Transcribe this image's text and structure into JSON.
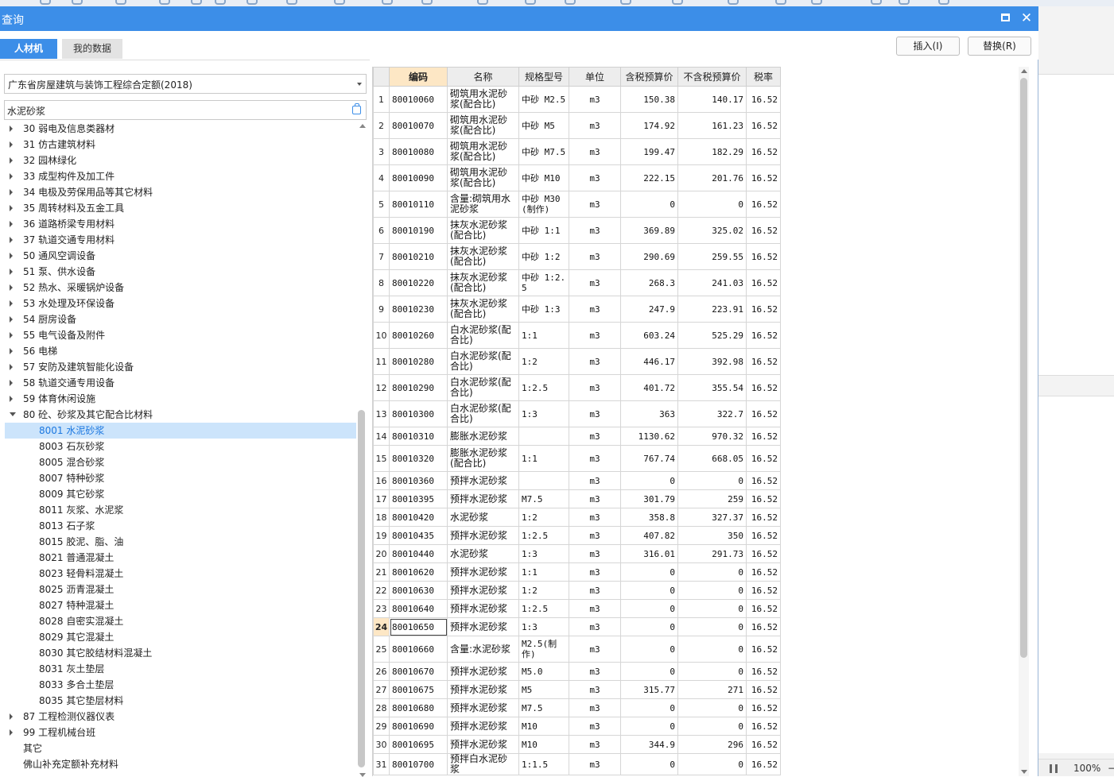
{
  "window": {
    "title": "查询"
  },
  "tabs": [
    {
      "label": "人材机",
      "active": true
    },
    {
      "label": "我的数据",
      "active": false
    }
  ],
  "toolbar": {
    "insert_label": "插入(I)",
    "replace_label": "替换(R)"
  },
  "quota_select": {
    "value": "广东省房屋建筑与装饰工程综合定额(2018)"
  },
  "search": {
    "value": "水泥砂浆"
  },
  "tree": [
    {
      "label": "30 弱电及信息类器材",
      "level": 0,
      "state": "collapsed"
    },
    {
      "label": "31 仿古建筑材料",
      "level": 0,
      "state": "collapsed"
    },
    {
      "label": "32 园林绿化",
      "level": 0,
      "state": "collapsed"
    },
    {
      "label": "33 成型构件及加工件",
      "level": 0,
      "state": "collapsed"
    },
    {
      "label": "34 电极及劳保用品等其它材料",
      "level": 0,
      "state": "collapsed"
    },
    {
      "label": "35 周转材料及五金工具",
      "level": 0,
      "state": "collapsed"
    },
    {
      "label": "36 道路桥梁专用材料",
      "level": 0,
      "state": "collapsed"
    },
    {
      "label": "37 轨道交通专用材料",
      "level": 0,
      "state": "collapsed"
    },
    {
      "label": "50 通风空调设备",
      "level": 0,
      "state": "collapsed"
    },
    {
      "label": "51 泵、供水设备",
      "level": 0,
      "state": "collapsed"
    },
    {
      "label": "52 热水、采暖锅炉设备",
      "level": 0,
      "state": "collapsed"
    },
    {
      "label": "53 水处理及环保设备",
      "level": 0,
      "state": "collapsed"
    },
    {
      "label": "54 厨房设备",
      "level": 0,
      "state": "collapsed"
    },
    {
      "label": "55 电气设备及附件",
      "level": 0,
      "state": "collapsed"
    },
    {
      "label": "56 电梯",
      "level": 0,
      "state": "collapsed"
    },
    {
      "label": "57 安防及建筑智能化设备",
      "level": 0,
      "state": "collapsed"
    },
    {
      "label": "58 轨道交通专用设备",
      "level": 0,
      "state": "collapsed"
    },
    {
      "label": "59 体育休闲设施",
      "level": 0,
      "state": "collapsed"
    },
    {
      "label": "80 砼、砂浆及其它配合比材料",
      "level": 0,
      "state": "expanded"
    },
    {
      "label": "8001 水泥砂浆",
      "level": 1,
      "state": "leaf",
      "selected": true
    },
    {
      "label": "8003 石灰砂浆",
      "level": 1,
      "state": "leaf"
    },
    {
      "label": "8005 混合砂浆",
      "level": 1,
      "state": "leaf"
    },
    {
      "label": "8007 特种砂浆",
      "level": 1,
      "state": "leaf"
    },
    {
      "label": "8009 其它砂浆",
      "level": 1,
      "state": "leaf"
    },
    {
      "label": "8011 灰浆、水泥浆",
      "level": 1,
      "state": "leaf"
    },
    {
      "label": "8013 石子浆",
      "level": 1,
      "state": "leaf"
    },
    {
      "label": "8015 胶泥、脂、油",
      "level": 1,
      "state": "leaf"
    },
    {
      "label": "8021 普通混凝土",
      "level": 1,
      "state": "leaf"
    },
    {
      "label": "8023 轻骨料混凝土",
      "level": 1,
      "state": "leaf"
    },
    {
      "label": "8025 沥青混凝土",
      "level": 1,
      "state": "leaf"
    },
    {
      "label": "8027 特种混凝土",
      "level": 1,
      "state": "leaf"
    },
    {
      "label": "8028 自密实混凝土",
      "level": 1,
      "state": "leaf"
    },
    {
      "label": "8029 其它混凝土",
      "level": 1,
      "state": "leaf"
    },
    {
      "label": "8030 其它胶结材料混凝土",
      "level": 1,
      "state": "leaf"
    },
    {
      "label": "8031 灰土垫层",
      "level": 1,
      "state": "leaf"
    },
    {
      "label": "8033 多合土垫层",
      "level": 1,
      "state": "leaf"
    },
    {
      "label": "8035 其它垫层材料",
      "level": 1,
      "state": "leaf"
    },
    {
      "label": "87 工程检测仪器仪表",
      "level": 0,
      "state": "collapsed"
    },
    {
      "label": "99 工程机械台班",
      "level": 0,
      "state": "collapsed"
    },
    {
      "label": "其它",
      "level": 0,
      "state": "none"
    },
    {
      "label": "佛山补充定额补充材料",
      "level": 0,
      "state": "none"
    }
  ],
  "grid": {
    "columns": [
      "编码",
      "名称",
      "规格型号",
      "单位",
      "含税预算价",
      "不含税预算价",
      "税率"
    ],
    "current_row": 24,
    "rows": [
      {
        "n": "1",
        "code": "80010060",
        "name": "砌筑用水泥砂浆(配合比)",
        "spec": "中砂 M2.5",
        "unit": "m3",
        "tax_price": "150.38",
        "notax_price": "140.17",
        "rate": "16.52"
      },
      {
        "n": "2",
        "code": "80010070",
        "name": "砌筑用水泥砂浆(配合比)",
        "spec": "中砂 M5",
        "unit": "m3",
        "tax_price": "174.92",
        "notax_price": "161.23",
        "rate": "16.52"
      },
      {
        "n": "3",
        "code": "80010080",
        "name": "砌筑用水泥砂浆(配合比)",
        "spec": "中砂 M7.5",
        "unit": "m3",
        "tax_price": "199.47",
        "notax_price": "182.29",
        "rate": "16.52"
      },
      {
        "n": "4",
        "code": "80010090",
        "name": "砌筑用水泥砂浆(配合比)",
        "spec": "中砂 M10",
        "unit": "m3",
        "tax_price": "222.15",
        "notax_price": "201.76",
        "rate": "16.52"
      },
      {
        "n": "5",
        "code": "80010110",
        "name": "含量:砌筑用水泥砂浆",
        "spec": "中砂 M30(制作)",
        "unit": "m3",
        "tax_price": "0",
        "notax_price": "0",
        "rate": "16.52"
      },
      {
        "n": "6",
        "code": "80010190",
        "name": "抹灰水泥砂浆(配合比)",
        "spec": "中砂 1:1",
        "unit": "m3",
        "tax_price": "369.89",
        "notax_price": "325.02",
        "rate": "16.52"
      },
      {
        "n": "7",
        "code": "80010210",
        "name": "抹灰水泥砂浆(配合比)",
        "spec": "中砂 1:2",
        "unit": "m3",
        "tax_price": "290.69",
        "notax_price": "259.55",
        "rate": "16.52"
      },
      {
        "n": "8",
        "code": "80010220",
        "name": "抹灰水泥砂浆(配合比)",
        "spec": "中砂 1:2.5",
        "unit": "m3",
        "tax_price": "268.3",
        "notax_price": "241.03",
        "rate": "16.52"
      },
      {
        "n": "9",
        "code": "80010230",
        "name": "抹灰水泥砂浆(配合比)",
        "spec": "中砂 1:3",
        "unit": "m3",
        "tax_price": "247.9",
        "notax_price": "223.91",
        "rate": "16.52"
      },
      {
        "n": "10",
        "code": "80010260",
        "name": "白水泥砂浆(配合比)",
        "spec": "1:1",
        "unit": "m3",
        "tax_price": "603.24",
        "notax_price": "525.29",
        "rate": "16.52"
      },
      {
        "n": "11",
        "code": "80010280",
        "name": "白水泥砂浆(配合比)",
        "spec": "1:2",
        "unit": "m3",
        "tax_price": "446.17",
        "notax_price": "392.98",
        "rate": "16.52"
      },
      {
        "n": "12",
        "code": "80010290",
        "name": "白水泥砂浆(配合比)",
        "spec": "1:2.5",
        "unit": "m3",
        "tax_price": "401.72",
        "notax_price": "355.54",
        "rate": "16.52"
      },
      {
        "n": "13",
        "code": "80010300",
        "name": "白水泥砂浆(配合比)",
        "spec": "1:3",
        "unit": "m3",
        "tax_price": "363",
        "notax_price": "322.7",
        "rate": "16.52"
      },
      {
        "n": "14",
        "code": "80010310",
        "name": "膨胀水泥砂浆",
        "spec": "",
        "unit": "m3",
        "tax_price": "1130.62",
        "notax_price": "970.32",
        "rate": "16.52"
      },
      {
        "n": "15",
        "code": "80010320",
        "name": "膨胀水泥砂浆(配合比)",
        "spec": "1:1",
        "unit": "m3",
        "tax_price": "767.74",
        "notax_price": "668.05",
        "rate": "16.52"
      },
      {
        "n": "16",
        "code": "80010360",
        "name": "预拌水泥砂浆",
        "spec": "",
        "unit": "m3",
        "tax_price": "0",
        "notax_price": "0",
        "rate": "16.52"
      },
      {
        "n": "17",
        "code": "80010395",
        "name": "预拌水泥砂浆",
        "spec": "M7.5",
        "unit": "m3",
        "tax_price": "301.79",
        "notax_price": "259",
        "rate": "16.52"
      },
      {
        "n": "18",
        "code": "80010420",
        "name": "水泥砂浆",
        "spec": "1:2",
        "unit": "m3",
        "tax_price": "358.8",
        "notax_price": "327.37",
        "rate": "16.52"
      },
      {
        "n": "19",
        "code": "80010435",
        "name": "预拌水泥砂浆",
        "spec": "1:2.5",
        "unit": "m3",
        "tax_price": "407.82",
        "notax_price": "350",
        "rate": "16.52"
      },
      {
        "n": "20",
        "code": "80010440",
        "name": "水泥砂浆",
        "spec": "1:3",
        "unit": "m3",
        "tax_price": "316.01",
        "notax_price": "291.73",
        "rate": "16.52"
      },
      {
        "n": "21",
        "code": "80010620",
        "name": "预拌水泥砂浆",
        "spec": "1:1",
        "unit": "m3",
        "tax_price": "0",
        "notax_price": "0",
        "rate": "16.52"
      },
      {
        "n": "22",
        "code": "80010630",
        "name": "预拌水泥砂浆",
        "spec": "1:2",
        "unit": "m3",
        "tax_price": "0",
        "notax_price": "0",
        "rate": "16.52"
      },
      {
        "n": "23",
        "code": "80010640",
        "name": "预拌水泥砂浆",
        "spec": "1:2.5",
        "unit": "m3",
        "tax_price": "0",
        "notax_price": "0",
        "rate": "16.52"
      },
      {
        "n": "24",
        "code": "80010650",
        "name": "预拌水泥砂浆",
        "spec": "1:3",
        "unit": "m3",
        "tax_price": "0",
        "notax_price": "0",
        "rate": "16.52"
      },
      {
        "n": "25",
        "code": "80010660",
        "name": "含量:水泥砂浆",
        "spec": "M2.5(制作)",
        "unit": "m3",
        "tax_price": "0",
        "notax_price": "0",
        "rate": "16.52"
      },
      {
        "n": "26",
        "code": "80010670",
        "name": "预拌水泥砂浆",
        "spec": "M5.0",
        "unit": "m3",
        "tax_price": "0",
        "notax_price": "0",
        "rate": "16.52"
      },
      {
        "n": "27",
        "code": "80010675",
        "name": "预拌水泥砂浆",
        "spec": "M5",
        "unit": "m3",
        "tax_price": "315.77",
        "notax_price": "271",
        "rate": "16.52"
      },
      {
        "n": "28",
        "code": "80010680",
        "name": "预拌水泥砂浆",
        "spec": "M7.5",
        "unit": "m3",
        "tax_price": "0",
        "notax_price": "0",
        "rate": "16.52"
      },
      {
        "n": "29",
        "code": "80010690",
        "name": "预拌水泥砂浆",
        "spec": "M10",
        "unit": "m3",
        "tax_price": "0",
        "notax_price": "0",
        "rate": "16.52"
      },
      {
        "n": "30",
        "code": "80010695",
        "name": "预拌水泥砂浆",
        "spec": "M10",
        "unit": "m3",
        "tax_price": "344.9",
        "notax_price": "296",
        "rate": "16.52"
      },
      {
        "n": "31",
        "code": "80010700",
        "name": "预拌白水泥砂浆",
        "spec": "1:1.5",
        "unit": "m3",
        "tax_price": "0",
        "notax_price": "0",
        "rate": "16.52"
      }
    ]
  },
  "statusbar": {
    "zoom": "100%",
    "zoom_out": "−"
  }
}
